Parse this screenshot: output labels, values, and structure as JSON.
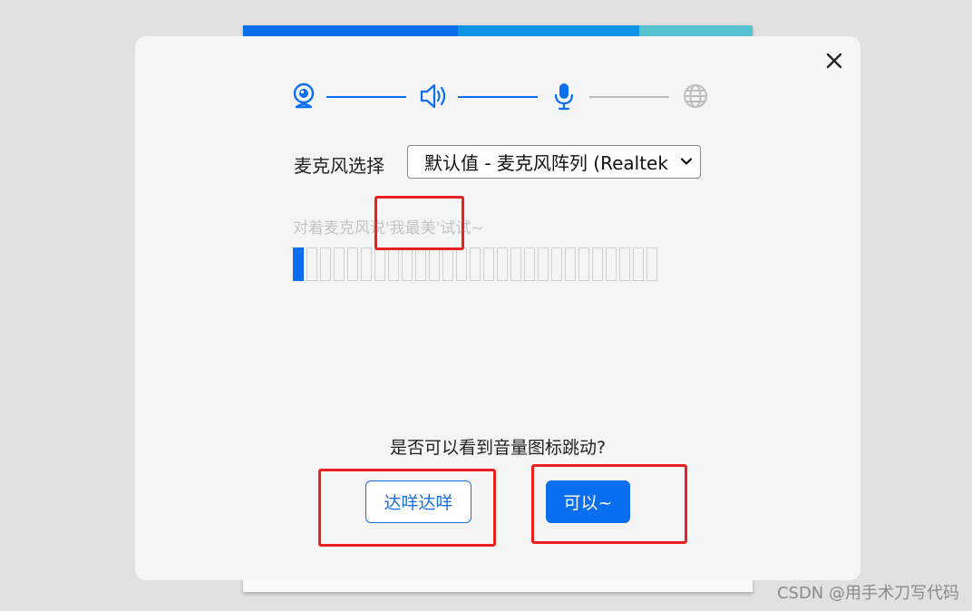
{
  "dialog": {
    "close_icon": "close-icon",
    "steps": [
      {
        "icon": "webcam-icon",
        "state": "done"
      },
      {
        "icon": "speaker-icon",
        "state": "done"
      },
      {
        "icon": "microphone-icon",
        "state": "active"
      },
      {
        "icon": "globe-icon",
        "state": "pending"
      }
    ],
    "mic_label": "麦克风选择",
    "mic_select_value": "默认值 - 麦克风阵列 (Realtek(",
    "hint": "对着麦克风说'我最美'试试~",
    "meter_level": 0.037,
    "question": "是否可以看到音量图标跳动?",
    "no_button": "达咩达咩",
    "yes_button": "可以~"
  },
  "colors": {
    "accent": "#0a6ef0",
    "pending": "#bdbdbd",
    "annotation": "#e8231f"
  },
  "watermark": "CSDN @用手术刀写代码"
}
